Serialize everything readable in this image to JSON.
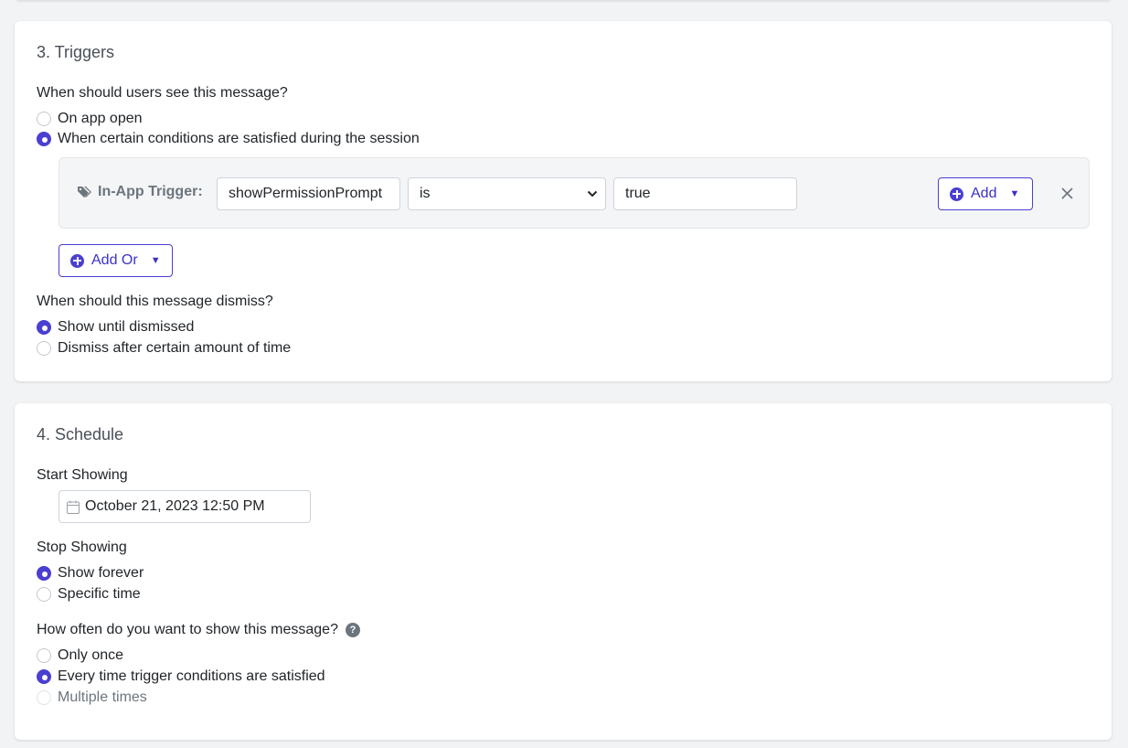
{
  "triggers": {
    "title": "3. Triggers",
    "when_label": "When should users see this message?",
    "when_options": [
      {
        "label": "On app open",
        "checked": false
      },
      {
        "label": "When certain conditions are satisfied during the session",
        "checked": true
      }
    ],
    "condition": {
      "label": "In-App Trigger:",
      "field_value": "showPermissionPrompt",
      "operator_value": "is",
      "value": "true",
      "add_label": "Add"
    },
    "add_or_label": "Add Or",
    "dismiss_label": "When should this message dismiss?",
    "dismiss_options": [
      {
        "label": "Show until dismissed",
        "checked": true
      },
      {
        "label": "Dismiss after certain amount of time",
        "checked": false
      }
    ]
  },
  "schedule": {
    "title": "4. Schedule",
    "start_label": "Start Showing",
    "start_value": "October 21, 2023 12:50 PM",
    "stop_label": "Stop Showing",
    "stop_options": [
      {
        "label": "Show forever",
        "checked": true
      },
      {
        "label": "Specific time",
        "checked": false
      }
    ],
    "frequency_label": "How often do you want to show this message?",
    "frequency_options": [
      {
        "label": "Only once",
        "checked": false
      },
      {
        "label": "Every time trigger conditions are satisfied",
        "checked": true
      },
      {
        "label": "Multiple times",
        "checked": false,
        "disabled": true
      }
    ]
  },
  "colors": {
    "accent": "#4a3fd1",
    "background": "#f2f3f5"
  }
}
